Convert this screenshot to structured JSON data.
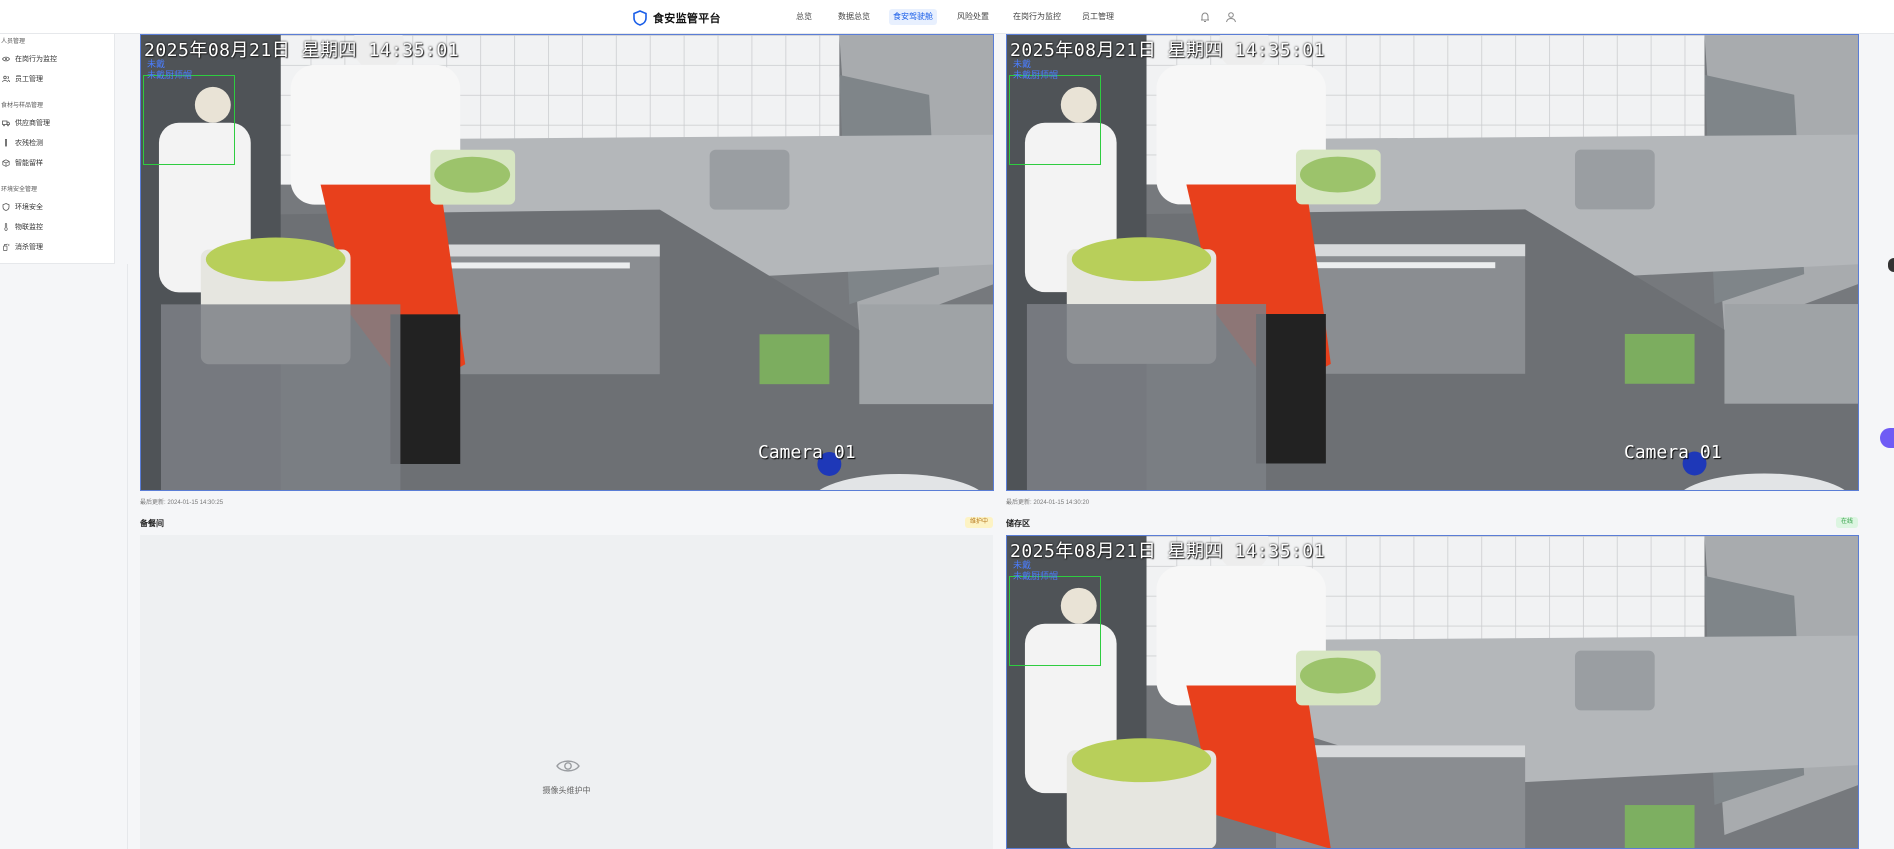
{
  "app": {
    "title": "食安监管平台",
    "accent": "#1a5ee8"
  },
  "nav": {
    "items": [
      {
        "label": "总览",
        "active": false
      },
      {
        "label": "数据总览",
        "active": false
      },
      {
        "label": "食安驾驶舱",
        "active": true
      },
      {
        "label": "风险处置",
        "active": false
      },
      {
        "label": "在岗行为监控",
        "active": false
      },
      {
        "label": "员工管理",
        "active": false
      }
    ],
    "icons": [
      "bell-icon",
      "user-icon"
    ]
  },
  "sidebar": {
    "groups": [
      {
        "title": "人员管理",
        "items": [
          {
            "label": "在岗行为监控",
            "icon": "eye-icon"
          },
          {
            "label": "员工管理",
            "icon": "users-icon"
          }
        ]
      },
      {
        "title": "食材与样品管理",
        "items": [
          {
            "label": "供应商管理",
            "icon": "truck-icon"
          },
          {
            "label": "农残检测",
            "icon": "tube-icon"
          },
          {
            "label": "智能留样",
            "icon": "box-icon"
          }
        ]
      },
      {
        "title": "环境安全管理",
        "items": [
          {
            "label": "环境安全",
            "icon": "shield-icon"
          },
          {
            "label": "物联监控",
            "icon": "thermometer-icon"
          },
          {
            "label": "消杀管理",
            "icon": "spray-icon"
          }
        ]
      }
    ]
  },
  "feeds": {
    "overlay_time": "2025年08月21日 星期四 14:35:01",
    "camera_label": "Camera 01",
    "overlay_tag_line1": "未戴",
    "overlay_tag_line2": "未戴厨师帽",
    "top_left": {
      "updated": "最后更新: 2024-01-15 14:30:25"
    },
    "top_right": {
      "updated": "最后更新: 2024-01-15 14:30:20"
    },
    "bottom_left": {
      "title": "备餐间",
      "status": "维护中",
      "placeholder": "摄像头维护中"
    },
    "bottom_right": {
      "title": "储存区",
      "status": "在线"
    }
  }
}
